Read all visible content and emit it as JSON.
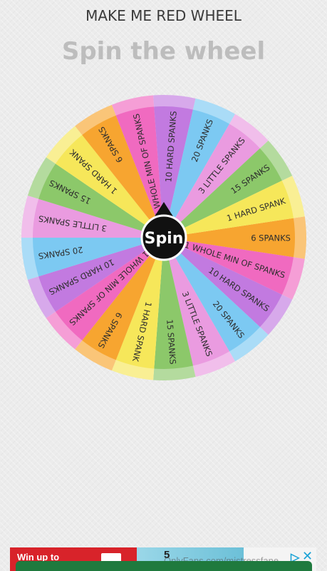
{
  "header": {
    "wheel_name": "MAKE ME RED WHEEL",
    "page_title": "Spin the wheel"
  },
  "wheel": {
    "spin_label": "Spin",
    "segments": [
      {
        "label": "6 SPANKS",
        "color": "#f7a530"
      },
      {
        "label": "1 WHOLE MIN OF SPANKS",
        "color": "#f06ac0"
      },
      {
        "label": "10 HARD SPANKS",
        "color": "#c27ae0"
      },
      {
        "label": "20 SPANKS",
        "color": "#7cc9f2"
      },
      {
        "label": "3 LITTLE SPANKS",
        "color": "#ea9be0"
      },
      {
        "label": "15 SPANKS",
        "color": "#8cc86a"
      },
      {
        "label": "1 HARD SPANK",
        "color": "#f6e75a"
      },
      {
        "label": "6 SPANKS",
        "color": "#f7a530"
      },
      {
        "label": "1 WHOLE MIN OF SPANKS",
        "color": "#f06ac0"
      },
      {
        "label": "10 HARD SPANKS",
        "color": "#c27ae0"
      },
      {
        "label": "20 SPANKS",
        "color": "#7cc9f2"
      },
      {
        "label": "3 LITTLE SPANKS",
        "color": "#ea9be0"
      },
      {
        "label": "15 SPANKS",
        "color": "#8cc86a"
      },
      {
        "label": "1 HARD SPANK",
        "color": "#f6e75a"
      },
      {
        "label": "6 SPANKS",
        "color": "#f7a530"
      },
      {
        "label": "1 WHOLE MIN OF SPANKS",
        "color": "#f06ac0"
      },
      {
        "label": "10 HARD SPANKS",
        "color": "#c27ae0"
      },
      {
        "label": "20 SPANKS",
        "color": "#7cc9f2"
      },
      {
        "label": "3 LITTLE SPANKS",
        "color": "#ea9be0"
      },
      {
        "label": "15 SPANKS",
        "color": "#8cc86a"
      },
      {
        "label": "1 HARD SPANK",
        "color": "#f6e75a"
      }
    ]
  },
  "ad": {
    "headline": "Win up to",
    "number": "5",
    "watermark": "OnlyFans.com/mistressfane",
    "choices_icon": "adchoices-icon",
    "close_icon": "close-icon"
  }
}
